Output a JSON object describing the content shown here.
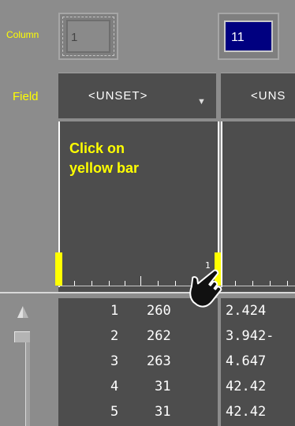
{
  "column_row": {
    "label": "Column",
    "value1": "1",
    "value2": "11"
  },
  "field_row": {
    "label": "Field",
    "dropdown1": "<UNSET>",
    "dropdown2": "<UNS"
  },
  "graph": {
    "hint_line1": "Click on",
    "hint_line2": "yellow bar",
    "tick_label": "1"
  },
  "table": {
    "rows": [
      {
        "index": "1",
        "value": "260",
        "col2": "2.424"
      },
      {
        "index": "2",
        "value": "262",
        "col2": "3.942-"
      },
      {
        "index": "3",
        "value": "263",
        "col2": "4.647"
      },
      {
        "index": "4",
        "value": "31",
        "col2": "42.42"
      },
      {
        "index": "5",
        "value": "31",
        "col2": "42.42"
      }
    ]
  },
  "colors": {
    "accent": "#ffff00",
    "panel": "#4d4d4d",
    "selected": "#000080"
  }
}
